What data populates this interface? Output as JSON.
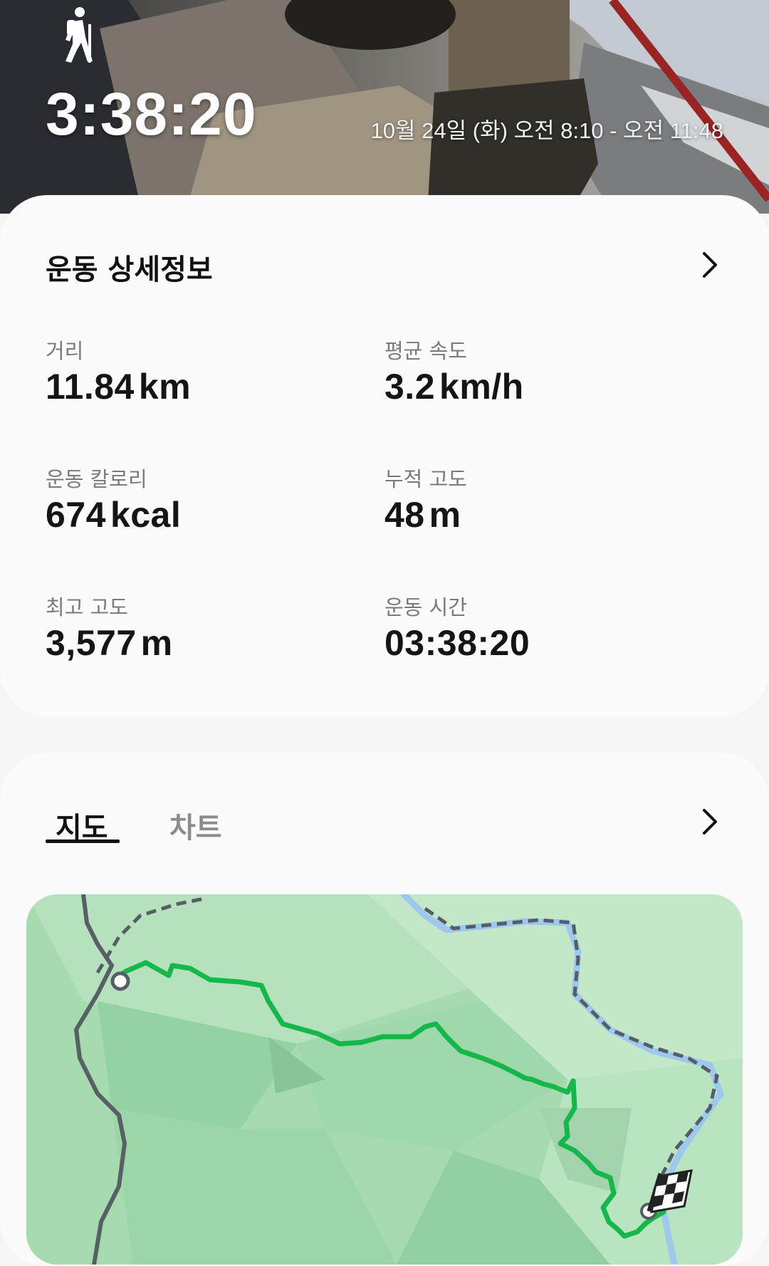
{
  "header": {
    "activity_icon": "hiking-icon",
    "duration": "3:38:20",
    "date_range": "10월 24일 (화) 오전 8:10 - 오전 11:48"
  },
  "details": {
    "title": "운동 상세정보",
    "more_icon": "chevron-right-icon",
    "stats": [
      {
        "label": "거리",
        "value": "11.84",
        "unit": "km"
      },
      {
        "label": "평균 속도",
        "value": "3.2",
        "unit": "km/h"
      },
      {
        "label": "운동 칼로리",
        "value": "674",
        "unit": "kcal"
      },
      {
        "label": "누적 고도",
        "value": "48",
        "unit": "m"
      },
      {
        "label": "최고 고도",
        "value": "3,577",
        "unit": "m"
      },
      {
        "label": "운동 시간",
        "value": "03:38:20",
        "unit": ""
      }
    ]
  },
  "map_section": {
    "tabs": [
      {
        "label": "지도",
        "selected": true
      },
      {
        "label": "차트",
        "selected": false
      }
    ],
    "more_icon": "chevron-right-icon",
    "start_marker_icon": "start-point-icon",
    "finish_marker_icon": "checkered-flag-icon"
  },
  "colors": {
    "route": "#14b84a",
    "map_land": "#a6dbb0",
    "water": "#9ec8ee",
    "trail_dashed": "#555d66"
  }
}
